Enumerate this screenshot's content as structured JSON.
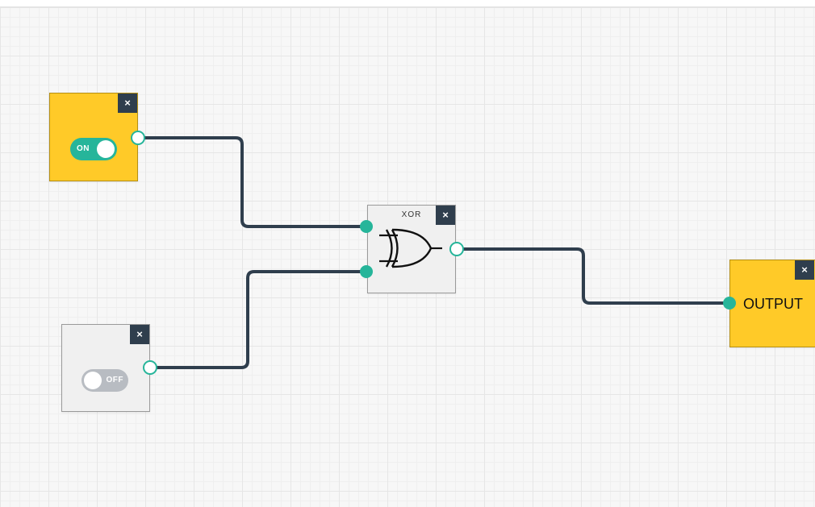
{
  "canvas": {
    "grid": true
  },
  "colors": {
    "node_on": "#ffca28",
    "node_off": "#f0f0f0",
    "wire": "#2f3e4d",
    "port": "#26b59a",
    "close_button": "#2f3e4d"
  },
  "nodes": {
    "switch_1": {
      "type": "switch",
      "state": "on",
      "toggle_label": "ON",
      "close_label": "×"
    },
    "switch_2": {
      "type": "switch",
      "state": "off",
      "toggle_label": "OFF",
      "close_label": "×"
    },
    "xor_gate": {
      "type": "gate",
      "title": "XOR",
      "icon": "xor-gate-icon",
      "close_label": "×"
    },
    "output": {
      "type": "output",
      "label": "OUTPUT",
      "close_label": "×"
    }
  },
  "connections": [
    {
      "from": "switch_1.out",
      "to": "xor_gate.in1"
    },
    {
      "from": "switch_2.out",
      "to": "xor_gate.in2"
    },
    {
      "from": "xor_gate.out",
      "to": "output.in"
    }
  ]
}
